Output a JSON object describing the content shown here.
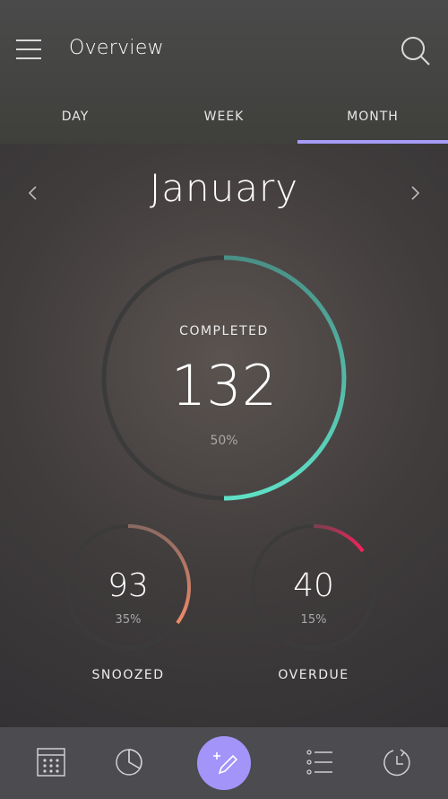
{
  "header": {
    "title": "Overview",
    "menu_icon": "hamburger-menu-icon",
    "search_icon": "search-icon"
  },
  "tabs": [
    {
      "label": "DAY",
      "active": false
    },
    {
      "label": "WEEK",
      "active": false
    },
    {
      "label": "MONTH",
      "active": true
    }
  ],
  "period": {
    "label": "January",
    "prev_icon": "chevron-left-icon",
    "next_icon": "chevron-right-icon"
  },
  "completed": {
    "label": "COMPLETED",
    "value": "132",
    "percent_label": "50%",
    "fraction": 0.5,
    "color_start": "#4aa094",
    "color_end": "#5fe0c6"
  },
  "snoozed": {
    "label": "SNOOZED",
    "value": "93",
    "percent_label": "35%",
    "fraction": 0.35,
    "color": "#e8876a"
  },
  "overdue": {
    "label": "OVERDUE",
    "value": "40",
    "percent_label": "15%",
    "fraction": 0.15,
    "color": "#ff1f5a"
  },
  "colors": {
    "accent": "#a79bf8",
    "fab": "#a294f9"
  },
  "bottom_nav": [
    "calendar-icon",
    "pie-chart-icon",
    "add-note-icon",
    "list-icon",
    "history-icon"
  ]
}
